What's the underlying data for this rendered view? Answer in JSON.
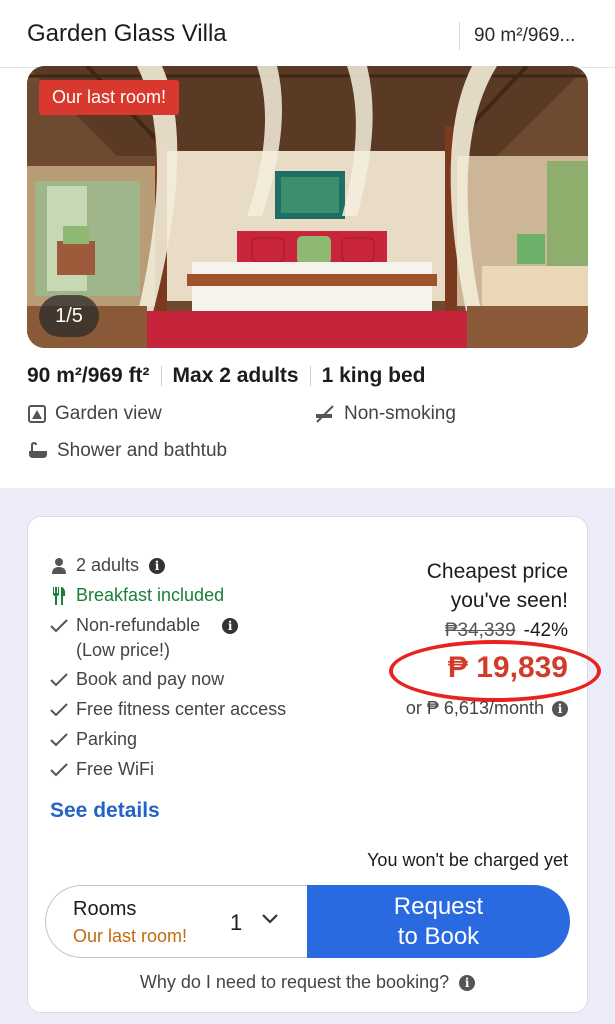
{
  "header": {
    "title": "Garden Glass Villa",
    "size": "90 m²/969..."
  },
  "photo": {
    "badge": "Our last room!",
    "counter": "1/5"
  },
  "specs": {
    "size": "90 m²/969 ft²",
    "occupancy": "Max 2 adults",
    "bed": "1 king bed"
  },
  "amenities": {
    "view": "Garden view",
    "smoking": "Non-smoking",
    "bath": "Shower and bathtub"
  },
  "offer": {
    "features": [
      "2 adults",
      "Breakfast included",
      "Non-refundable",
      "(Low price!)",
      "Book and pay now",
      "Free fitness center access",
      "Parking",
      "Free WiFi"
    ],
    "see_details": "See details",
    "cheapest_line1": "Cheapest price",
    "cheapest_line2": "you've seen!",
    "old_price": "₱34,339",
    "discount": "-42%",
    "price": "₱ 19,839",
    "monthly": "or ₱ 6,613/month",
    "not_charged": "You won't be charged yet",
    "rooms_label": "Rooms",
    "rooms_note": "Our last room!",
    "rooms_qty": "1",
    "request_line1": "Request",
    "request_line2": "to Book",
    "why_request": "Why do I need to request the booking?"
  },
  "colors": {
    "accent_blue": "#2a6ae0",
    "link_blue": "#2563c9",
    "price_red": "#d13b2a",
    "badge_red": "#d9382e",
    "green": "#1a7f37",
    "orange": "#c06a10",
    "panel_bg": "#ecedf8"
  },
  "icons": {
    "occupancy": "person-icon",
    "breakfast": "fork-knife-icon",
    "check": "check-icon",
    "info": "info-icon",
    "view": "garden-view-icon",
    "smoking": "no-smoking-icon",
    "bath": "bathtub-icon",
    "dropdown": "chevron-down-icon"
  }
}
